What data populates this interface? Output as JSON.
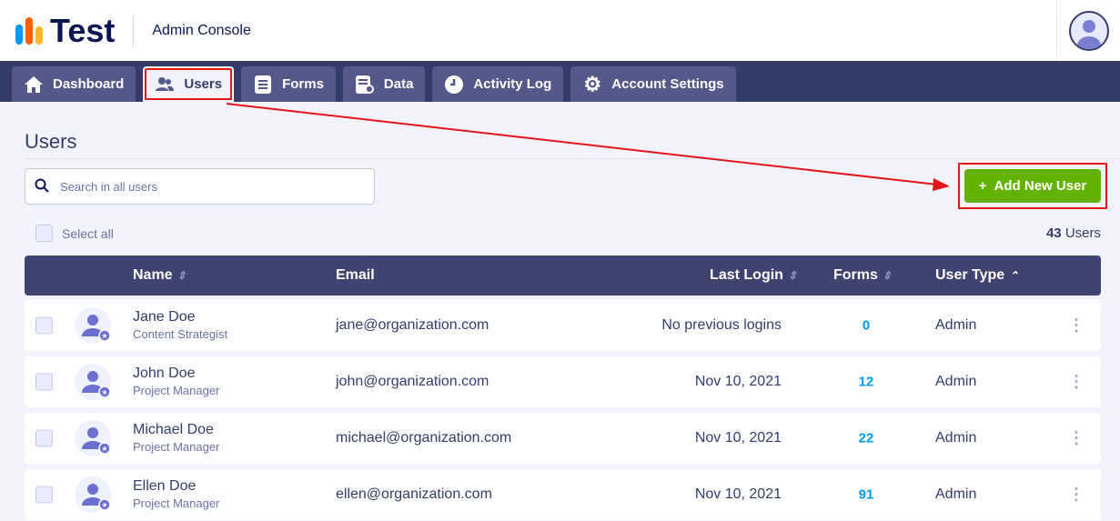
{
  "header": {
    "brand": "Test",
    "subtitle": "Admin Console"
  },
  "nav": {
    "tabs": [
      {
        "label": "Dashboard"
      },
      {
        "label": "Users"
      },
      {
        "label": "Forms"
      },
      {
        "label": "Data"
      },
      {
        "label": "Activity Log"
      },
      {
        "label": "Account Settings"
      }
    ]
  },
  "page": {
    "title": "Users",
    "search_placeholder": "Search in all users",
    "add_button": "Add New User",
    "select_all": "Select all",
    "count_num": "43",
    "count_label": "Users"
  },
  "table": {
    "columns": [
      "Name",
      "Email",
      "Last Login",
      "Forms",
      "User Type"
    ],
    "rows": [
      {
        "name": "Jane Doe",
        "role": "Content Strategist",
        "email": "jane@organization.com",
        "last_login": "No previous logins",
        "forms": "0",
        "type": "Admin"
      },
      {
        "name": "John Doe",
        "role": "Project Manager",
        "email": "john@organization.com",
        "last_login": "Nov 10, 2021",
        "forms": "12",
        "type": "Admin"
      },
      {
        "name": "Michael Doe",
        "role": "Project Manager",
        "email": "michael@organization.com",
        "last_login": "Nov 10, 2021",
        "forms": "22",
        "type": "Admin"
      },
      {
        "name": "Ellen Doe",
        "role": "Project Manager",
        "email": "ellen@organization.com",
        "last_login": "Nov 10, 2021",
        "forms": "91",
        "type": "Admin"
      }
    ]
  },
  "colors": {
    "accent": "#64b200",
    "nav": "#343c6a",
    "annotation": "#e3141a",
    "link": "#0099ff"
  }
}
